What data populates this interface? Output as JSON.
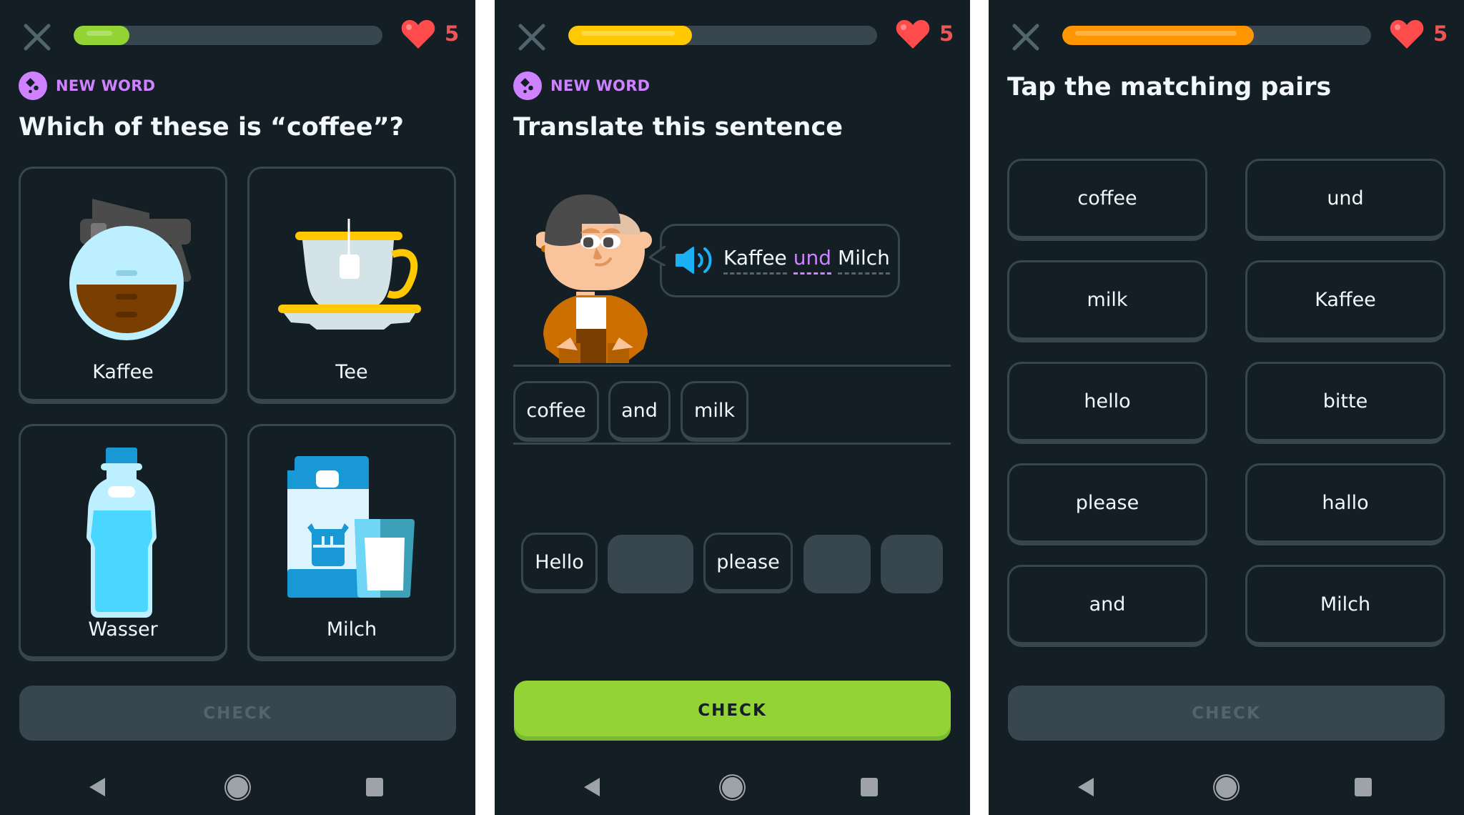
{
  "colors": {
    "background": "#131f24",
    "border": "#37464f",
    "accent_purple": "#ce82ff",
    "heart_red": "#ff4b4b",
    "check_green": "#93d333"
  },
  "screens": [
    {
      "progress": {
        "percent": 18,
        "color": "#93d333"
      },
      "hearts": "5",
      "badge": {
        "icon": "new-word-icon",
        "label": "NEW WORD"
      },
      "prompt": "Which of these is “coffee”?",
      "options": [
        {
          "label": "Kaffee",
          "icon": "coffee-pot-icon"
        },
        {
          "label": "Tee",
          "icon": "tea-cup-icon"
        },
        {
          "label": "Wasser",
          "icon": "water-bottle-icon"
        },
        {
          "label": "Milch",
          "icon": "milk-carton-icon"
        }
      ],
      "check_label": "CHECK",
      "check_enabled": false
    },
    {
      "progress": {
        "percent": 40,
        "color": "#ffc800"
      },
      "hearts": "5",
      "badge": {
        "icon": "new-word-icon",
        "label": "NEW WORD"
      },
      "prompt": "Translate this sentence",
      "speech": {
        "icon": "speaker-icon",
        "words": [
          {
            "text": "Kaffee",
            "highlight": false
          },
          {
            "text": "und",
            "highlight": true
          },
          {
            "text": "Milch",
            "highlight": false
          }
        ]
      },
      "answer_words": [
        "coffee",
        "and",
        "milk"
      ],
      "word_bank": [
        {
          "text": "Hello",
          "used": false
        },
        {
          "text": "",
          "used": true
        },
        {
          "text": "please",
          "used": false
        },
        {
          "text": "",
          "used": true
        },
        {
          "text": "",
          "used": true
        }
      ],
      "check_label": "CHECK",
      "check_enabled": true
    },
    {
      "progress": {
        "percent": 62,
        "color": "#ff9600"
      },
      "hearts": "5",
      "prompt": "Tap the matching pairs",
      "left_column": [
        "coffee",
        "milk",
        "hello",
        "please",
        "and"
      ],
      "right_column": [
        "und",
        "Kaffee",
        "bitte",
        "hallo",
        "Milch"
      ],
      "check_label": "CHECK",
      "check_enabled": false
    }
  ],
  "navbar": {
    "back": "back-icon",
    "home": "home-icon",
    "recents": "recents-icon"
  }
}
